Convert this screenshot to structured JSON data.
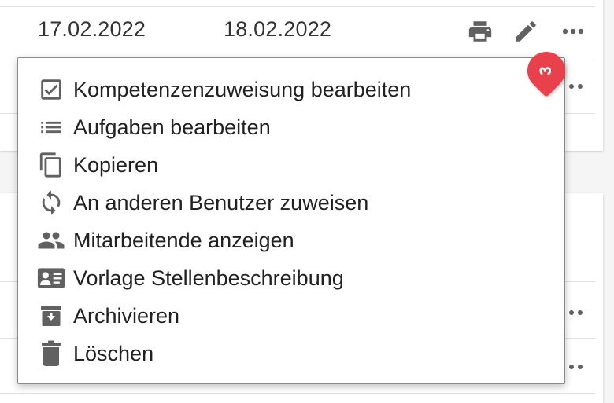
{
  "rows": {
    "first": {
      "start_date": "17.02.2022",
      "end_date": "18.02.2022"
    }
  },
  "menu": {
    "items": [
      {
        "icon": "checkbox-edit-icon",
        "label": "Kompetenzenzuweisung bearbeiten"
      },
      {
        "icon": "list-icon",
        "label": "Aufgaben bearbeiten"
      },
      {
        "icon": "copy-icon",
        "label": "Kopieren"
      },
      {
        "icon": "sync-icon",
        "label": "An anderen Benutzer zuweisen"
      },
      {
        "icon": "people-icon",
        "label": "Mitarbeitende anzeigen"
      },
      {
        "icon": "id-card-icon",
        "label": "Vorlage Stellenbeschreibung"
      },
      {
        "icon": "archive-icon",
        "label": "Archivieren"
      },
      {
        "icon": "trash-icon",
        "label": "Löschen"
      }
    ]
  },
  "step_badge": {
    "number": "3",
    "color": "#e8414b"
  },
  "colors": {
    "icon": "#616161",
    "divider": "#e0e0e0",
    "menu_border": "#8a8a8a"
  }
}
